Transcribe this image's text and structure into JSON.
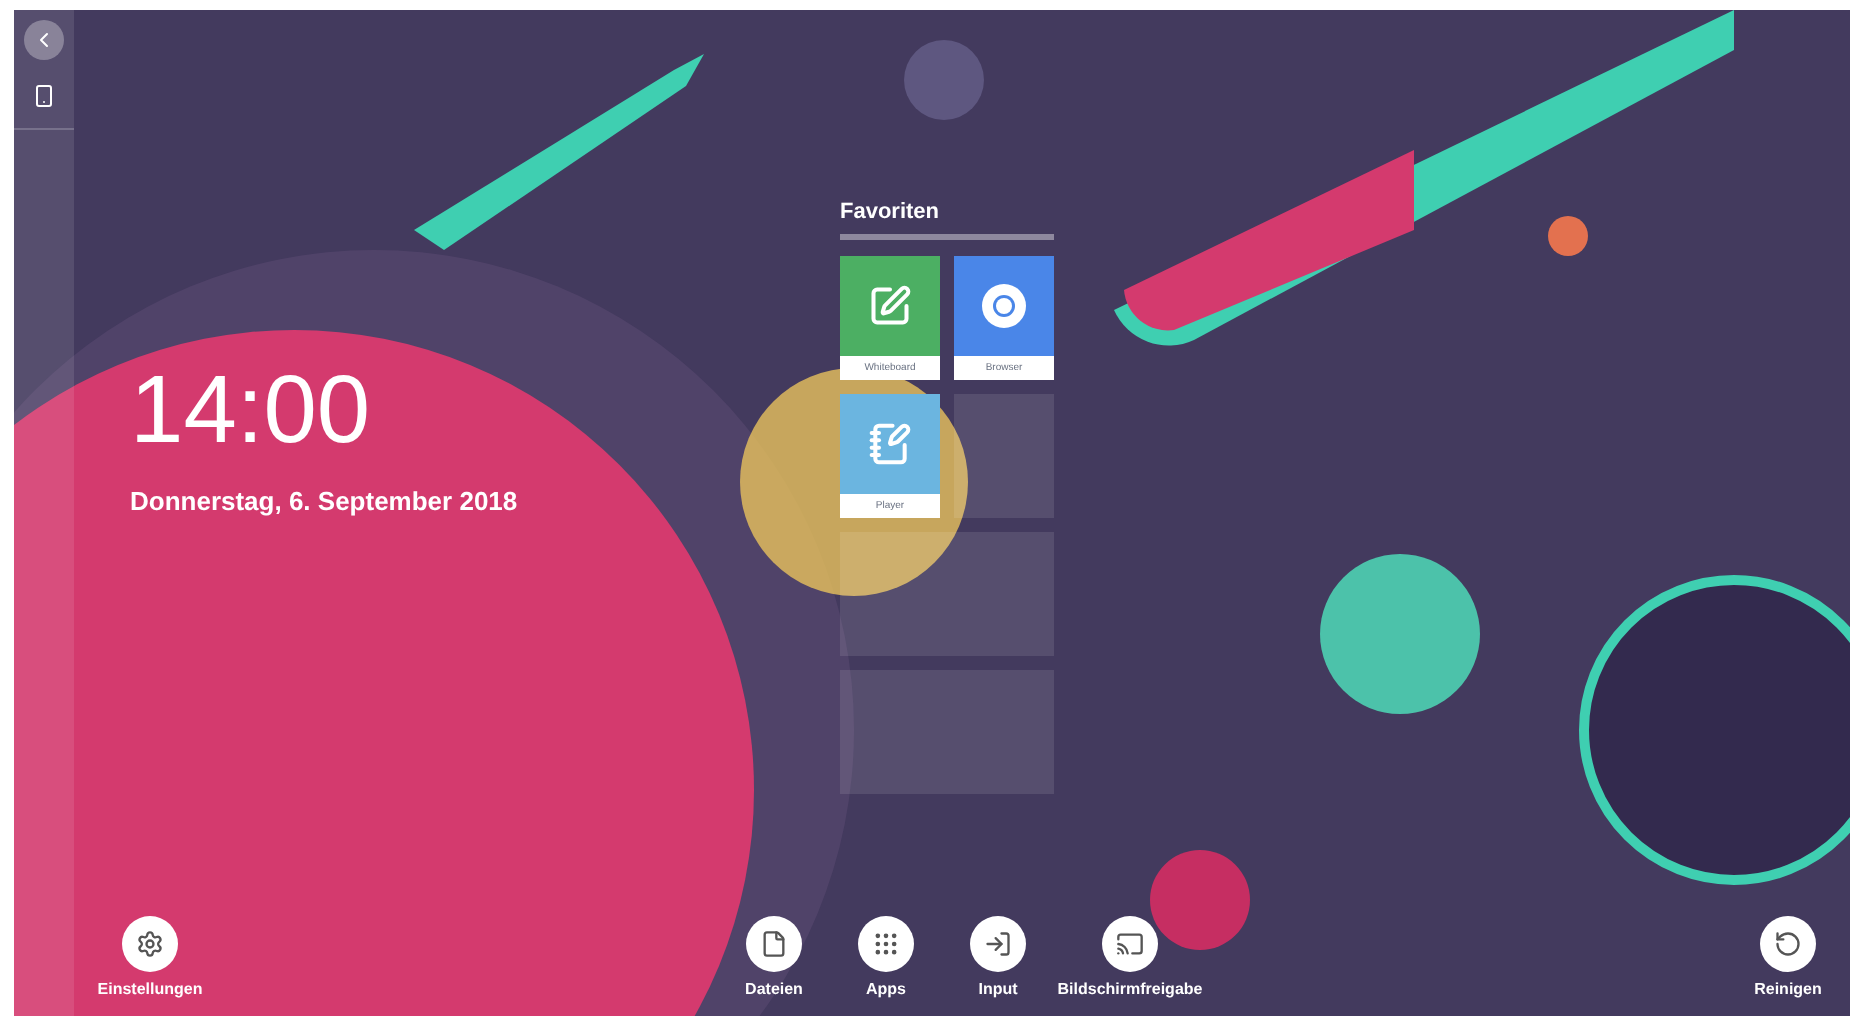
{
  "clock": {
    "time": "14:00",
    "date": "Donnerstag, 6. September 2018"
  },
  "favorites": {
    "title": "Favoriten",
    "apps": [
      {
        "label": "Whiteboard",
        "kind": "whiteboard"
      },
      {
        "label": "Browser",
        "kind": "browser"
      },
      {
        "label": "Player",
        "kind": "player"
      }
    ]
  },
  "dock": {
    "left": [
      {
        "label": "Einstellungen",
        "kind": "settings"
      }
    ],
    "center": [
      {
        "label": "Dateien",
        "kind": "files"
      },
      {
        "label": "Apps",
        "kind": "apps"
      },
      {
        "label": "Input",
        "kind": "input"
      },
      {
        "label": "Bildschirmfreigabe",
        "kind": "cast"
      }
    ],
    "right": [
      {
        "label": "Reinigen",
        "kind": "reset"
      }
    ]
  }
}
